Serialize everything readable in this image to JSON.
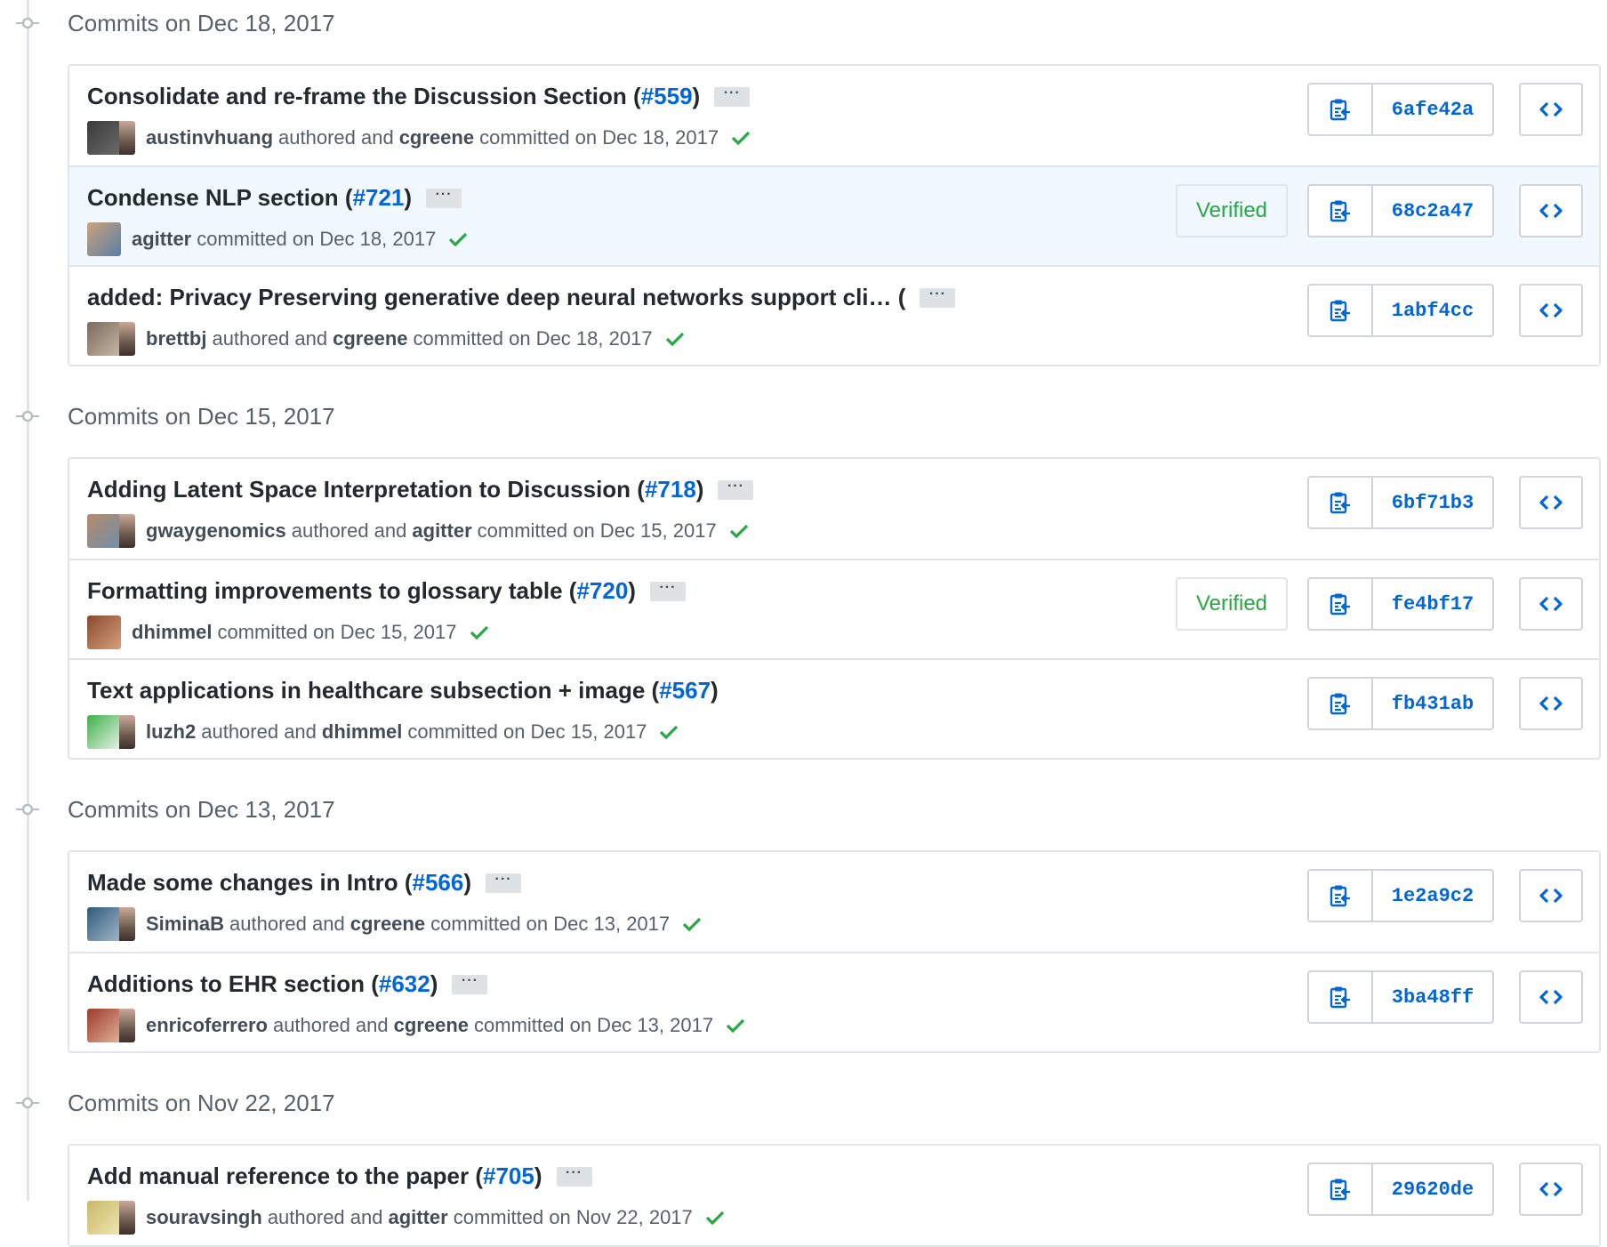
{
  "colors": {
    "link": "#0366d6",
    "verified": "#28a745",
    "check": "#28a745",
    "highlight_row": "#f1f8ff",
    "border": "#e1e4e8"
  },
  "icons": {
    "timeline": "git-commit-icon",
    "copy": "clippy-icon",
    "browse": "code-icon",
    "status": "check-icon"
  },
  "groups": [
    {
      "header": "Commits on Dec 18, 2017",
      "commits": [
        {
          "title": "Consolidate and re-frame the Discussion Section (",
          "pr": "#559",
          "title_end": ")",
          "author": "austinvhuang",
          "connector": "authored and",
          "committer": "cgreene",
          "date_text": "committed on Dec 18, 2017",
          "verified": "",
          "sha": "6afe42a",
          "highlight": false,
          "has_ellipsis": true
        },
        {
          "title": "Condense NLP section (",
          "pr": "#721",
          "title_end": ")",
          "author": "agitter",
          "connector": "",
          "committer": "",
          "date_text": "committed on Dec 18, 2017",
          "verified": "Verified",
          "sha": "68c2a47",
          "highlight": true,
          "has_ellipsis": true
        },
        {
          "title": "added: Privacy Preserving generative deep neural networks support cli… (",
          "pr": "",
          "title_end": "",
          "author": "brettbj",
          "connector": "authored and",
          "committer": "cgreene",
          "date_text": "committed on Dec 18, 2017",
          "verified": "",
          "sha": "1abf4cc",
          "highlight": false,
          "has_ellipsis": true
        }
      ]
    },
    {
      "header": "Commits on Dec 15, 2017",
      "commits": [
        {
          "title": "Adding Latent Space Interpretation to Discussion (",
          "pr": "#718",
          "title_end": ")",
          "author": "gwaygenomics",
          "connector": "authored and",
          "committer": "agitter",
          "date_text": "committed on Dec 15, 2017",
          "verified": "",
          "sha": "6bf71b3",
          "highlight": false,
          "has_ellipsis": true
        },
        {
          "title": "Formatting improvements to glossary table (",
          "pr": "#720",
          "title_end": ")",
          "author": "dhimmel",
          "connector": "",
          "committer": "",
          "date_text": "committed on Dec 15, 2017",
          "verified": "Verified",
          "sha": "fe4bf17",
          "highlight": false,
          "has_ellipsis": true
        },
        {
          "title": "Text applications in healthcare subsection + image (",
          "pr": "#567",
          "title_end": ")",
          "author": "luzh2",
          "connector": "authored and",
          "committer": "dhimmel",
          "date_text": "committed on Dec 15, 2017",
          "verified": "",
          "sha": "fb431ab",
          "highlight": false,
          "has_ellipsis": false
        }
      ]
    },
    {
      "header": "Commits on Dec 13, 2017",
      "commits": [
        {
          "title": "Made some changes in Intro (",
          "pr": "#566",
          "title_end": ")",
          "author": "SiminaB",
          "connector": "authored and",
          "committer": "cgreene",
          "date_text": "committed on Dec 13, 2017",
          "verified": "",
          "sha": "1e2a9c2",
          "highlight": false,
          "has_ellipsis": true
        },
        {
          "title": "Additions to EHR section (",
          "pr": "#632",
          "title_end": ")",
          "author": "enricoferrero",
          "connector": "authored and",
          "committer": "cgreene",
          "date_text": "committed on Dec 13, 2017",
          "verified": "",
          "sha": "3ba48ff",
          "highlight": false,
          "has_ellipsis": true
        }
      ]
    },
    {
      "header": "Commits on Nov 22, 2017",
      "commits": [
        {
          "title": "Add manual reference to the paper (",
          "pr": "#705",
          "title_end": ")",
          "author": "souravsingh",
          "connector": "authored and",
          "committer": "agitter",
          "date_text": "committed on Nov 22, 2017",
          "verified": "",
          "sha": "29620de",
          "highlight": false,
          "has_ellipsis": true
        }
      ]
    }
  ],
  "ellipsis_label": "···"
}
